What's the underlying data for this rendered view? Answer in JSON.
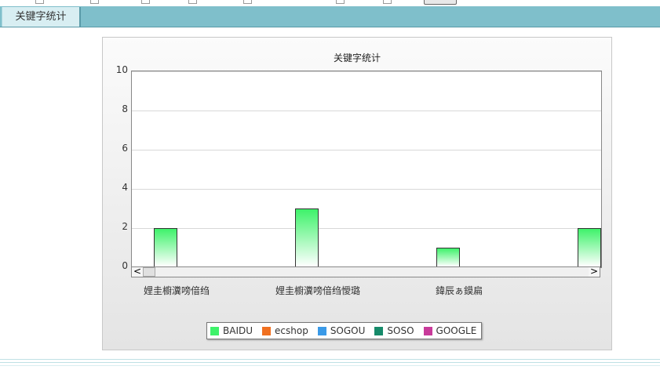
{
  "tab": {
    "label": "关键字统计"
  },
  "chart_data": {
    "type": "bar",
    "title": "关键字统计",
    "categories": [
      "娌圭櫥瀵嗙偣绉",
      "娌圭櫥瀵嗙偣绉懓璐",
      "鍏辰ぁ鏌扁",
      ""
    ],
    "series": [
      {
        "name": "BAIDU",
        "values": [
          2,
          3,
          1,
          2
        ]
      },
      {
        "name": "ecshop",
        "values": [
          0,
          0,
          0,
          0
        ]
      },
      {
        "name": "SOGOU",
        "values": [
          0,
          0,
          0,
          0
        ]
      },
      {
        "name": "SOSO",
        "values": [
          0,
          0,
          0,
          0
        ]
      },
      {
        "name": "GOOGLE",
        "values": [
          0,
          0,
          0,
          0
        ]
      }
    ],
    "yticks": [
      "0",
      "2",
      "4",
      "6",
      "8",
      "10"
    ],
    "ylim": [
      0,
      10
    ],
    "grid": true,
    "legend_position": "bottom"
  },
  "legend": [
    {
      "label": "BAIDU",
      "color": "#3ef26a"
    },
    {
      "label": "ecshop",
      "color": "#f07020"
    },
    {
      "label": "SOGOU",
      "color": "#3a9ae8"
    },
    {
      "label": "SOSO",
      "color": "#168a6a"
    },
    {
      "label": "GOOGLE",
      "color": "#c83a9a"
    }
  ],
  "scrollbar": {
    "left_arrow": "<",
    "right_arrow": ">"
  }
}
